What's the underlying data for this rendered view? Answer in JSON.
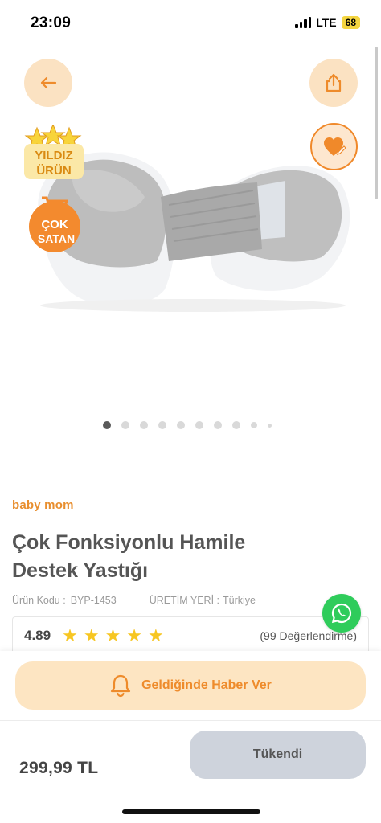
{
  "status_bar": {
    "time": "23:09",
    "network": "LTE",
    "battery": "68"
  },
  "icons": {
    "back": "arrow-left-icon",
    "share": "share-icon",
    "favorite": "heart-edit-icon",
    "whatsapp": "whatsapp-icon",
    "bell": "bell-icon",
    "cart": "cart-icon"
  },
  "badges": {
    "star_line1": "YILDIZ",
    "star_line2": "ÜRÜN",
    "cok_line1": "ÇOK",
    "cok_line2": "SATAN"
  },
  "carousel": {
    "count": 10,
    "active_index": 0
  },
  "product": {
    "brand": "baby mom",
    "title": "Çok Fonksiyonlu Hamile Destek Yastığı",
    "code_label": "Ürün Kodu :",
    "code_value": "BYP-1453",
    "origin_label": "ÜRETİM YERİ :",
    "origin_value": "Türkiye",
    "rating": "4.89",
    "stars": 5,
    "reviews": "(99 Değerlendirme)"
  },
  "actions": {
    "notify_label": "Geldiğinde Haber Ver",
    "soldout_label": "Tükendi"
  },
  "price": "299,99 TL",
  "colors": {
    "accent": "#ee8b2b",
    "accent_light": "#fde5c2",
    "whatsapp": "#2fcc5b",
    "star": "#f7c622"
  }
}
